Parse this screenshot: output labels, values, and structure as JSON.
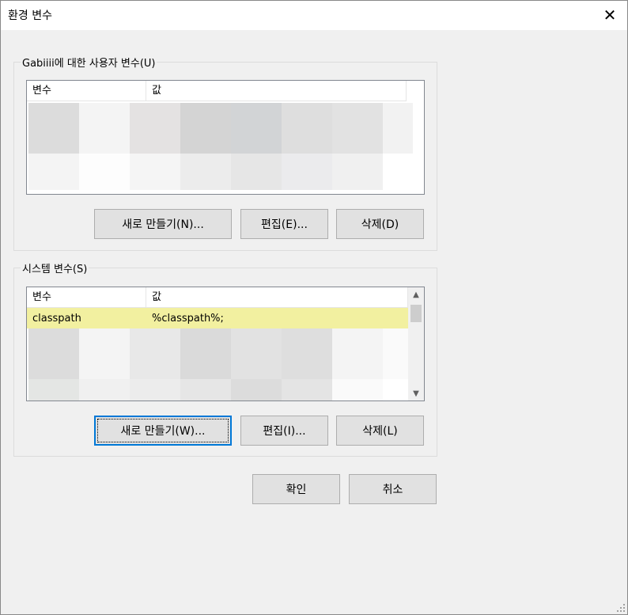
{
  "window": {
    "title": "환경 변수",
    "close_glyph": "✕"
  },
  "user_vars": {
    "group_label": "Gabiiii에 대한 사용자 변수(U)",
    "columns": [
      "변수",
      "값"
    ],
    "buttons": {
      "new": "새로 만들기(N)...",
      "edit": "편집(E)...",
      "delete": "삭제(D)"
    }
  },
  "system_vars": {
    "group_label": "시스템 변수(S)",
    "columns": [
      "변수",
      "값"
    ],
    "rows": [
      {
        "name": "classpath",
        "value": "%classpath%;"
      }
    ],
    "buttons": {
      "new": "새로 만들기(W)...",
      "edit": "편집(I)...",
      "delete": "삭제(L)"
    }
  },
  "footer": {
    "ok": "확인",
    "cancel": "취소"
  },
  "colors": {
    "selected_row": "#f2f0a0",
    "focus_border": "#0078d7",
    "button_face": "#e1e1e1"
  }
}
